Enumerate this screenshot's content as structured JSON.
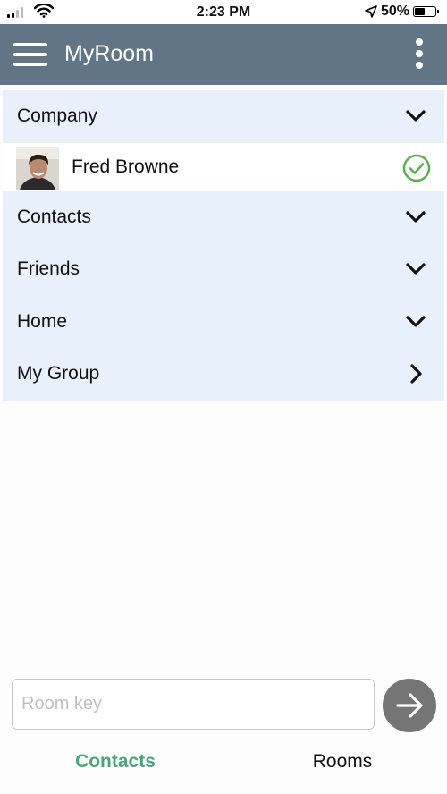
{
  "status_bar": {
    "time": "2:23 PM",
    "battery_text": "50%",
    "battery_level": 0.5,
    "icons": [
      "cellular-signal-icon",
      "wifi-icon",
      "location-arrow-icon",
      "battery-icon"
    ]
  },
  "app_bar": {
    "title": "MyRoom",
    "icons": [
      "hamburger-menu-icon",
      "more-vertical-icon"
    ]
  },
  "groups": [
    {
      "label": "Company",
      "state": "expanded",
      "contacts": [
        {
          "name": "Fred Browne",
          "status": "online"
        }
      ]
    },
    {
      "label": "Contacts",
      "state": "expanded"
    },
    {
      "label": "Friends",
      "state": "expanded"
    },
    {
      "label": "Home",
      "state": "expanded"
    },
    {
      "label": "My Group",
      "state": "collapsed"
    }
  ],
  "room_key": {
    "placeholder": "Room key",
    "value": ""
  },
  "tabs": {
    "contacts": "Contacts",
    "rooms": "Rooms",
    "active": "contacts"
  },
  "colors": {
    "app_bar": "#617587",
    "group_row": "#e8f0fb",
    "active_tab": "#4aa57c",
    "status_ok": "#5cae4f",
    "go_button": "#757575"
  }
}
